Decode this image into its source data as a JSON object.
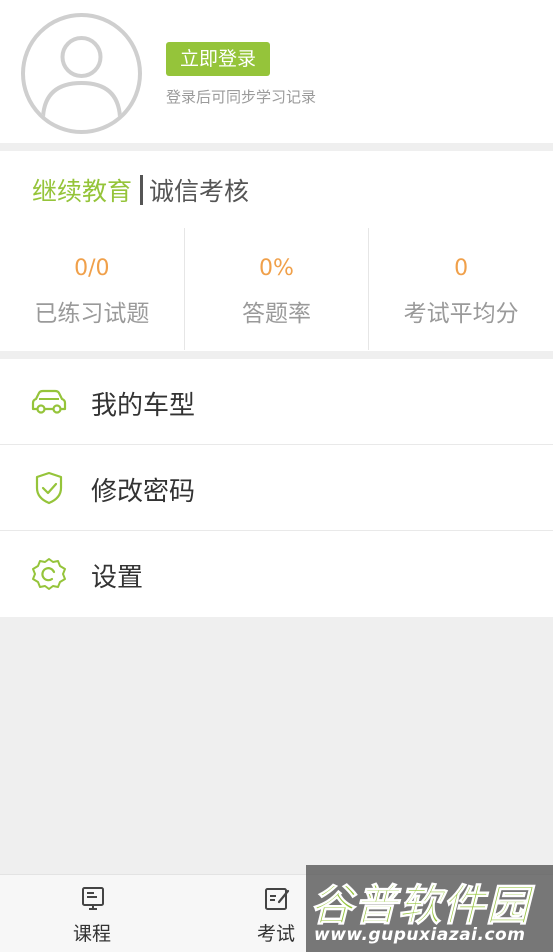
{
  "profile": {
    "login_button": "立即登录",
    "login_hint": "登录后可同步学习记录",
    "avatar_icon": "default-user-avatar"
  },
  "tabs": {
    "active": "继续教育",
    "inactive": "诚信考核"
  },
  "stats": [
    {
      "value": "0/0",
      "label": "已练习试题"
    },
    {
      "value": "0%",
      "label": "答题率"
    },
    {
      "value": "0",
      "label": "考试平均分"
    }
  ],
  "menu": [
    {
      "label": "我的车型",
      "icon": "car-icon"
    },
    {
      "label": "修改密码",
      "icon": "shield-check-icon"
    },
    {
      "label": "设置",
      "icon": "gear-icon"
    }
  ],
  "bottom_nav": [
    {
      "label": "课程",
      "icon": "course-icon"
    },
    {
      "label": "考试",
      "icon": "exam-icon"
    }
  ],
  "watermark": {
    "logo": "谷普软件园",
    "url": "www.gupuxiazai.com"
  },
  "colors": {
    "accent": "#95c43a",
    "stat_value": "#f0a04a",
    "background": "#efefef"
  }
}
